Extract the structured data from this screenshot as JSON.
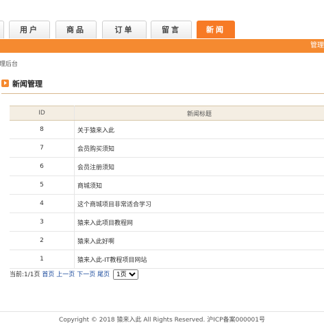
{
  "nav": {
    "tabs": [
      {
        "label": "用户",
        "active": false
      },
      {
        "label": "商品",
        "active": false
      },
      {
        "label": "订单",
        "active": false
      },
      {
        "label": "留言",
        "active": false
      },
      {
        "label": "新闻",
        "active": true
      }
    ],
    "admin_link": "管理"
  },
  "breadcrumb": "理后台",
  "section": {
    "title": "新闻管理"
  },
  "table": {
    "headers": [
      "ID",
      "新闻标题"
    ],
    "rows": [
      {
        "id": "8",
        "title": "关于猿来入此"
      },
      {
        "id": "7",
        "title": "会员购买须知"
      },
      {
        "id": "6",
        "title": "会员注册须知"
      },
      {
        "id": "5",
        "title": "商城须知"
      },
      {
        "id": "4",
        "title": "这个商城项目非常适合学习"
      },
      {
        "id": "3",
        "title": "猿来入此项目教程网"
      },
      {
        "id": "2",
        "title": "猿来入此好啊"
      },
      {
        "id": "1",
        "title": "猿来入此-IT教程项目网站"
      }
    ]
  },
  "pager": {
    "current_label": "当前:1/1页",
    "first": "首页",
    "prev": "上一页",
    "next": "下一页",
    "last": "尾页",
    "page_select": "1页"
  },
  "footer": "Copyright © 2018 猿来入此 All Rights Reserved. 沪ICP备案000001号",
  "colors": {
    "accent": "#f58a30",
    "active_tab": "#f77a25",
    "link": "#1a4a9c"
  }
}
